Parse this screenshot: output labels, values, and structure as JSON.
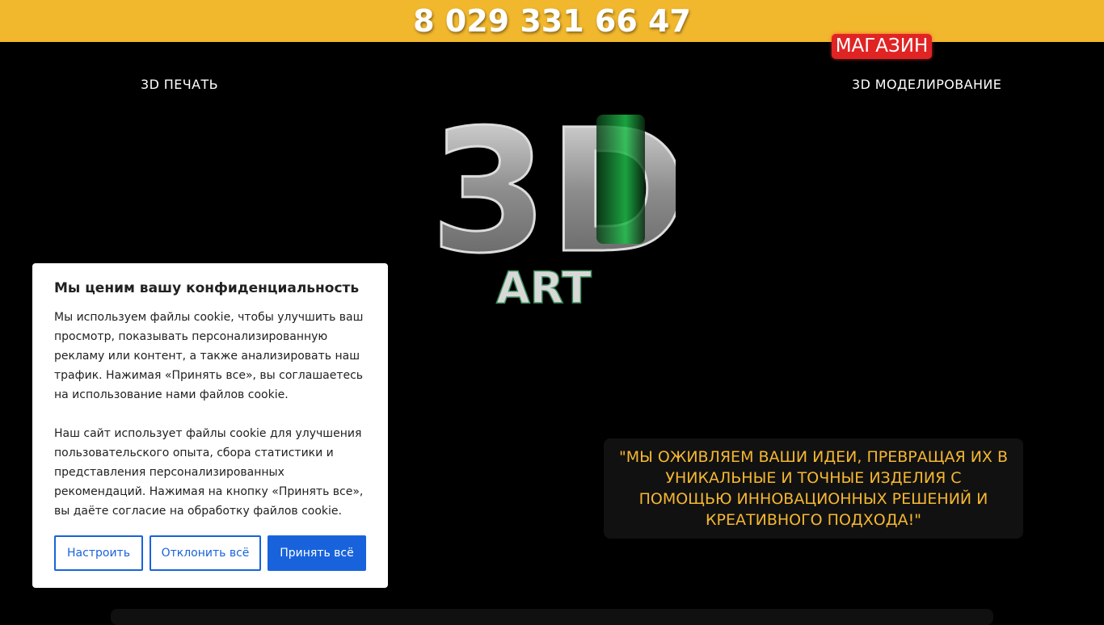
{
  "header": {
    "phone": "8 029 331 66 47"
  },
  "nav": {
    "shop": "МАГАЗИН",
    "left_link": "3D ПЕЧАТЬ",
    "right_link": "3D МОДЕЛИРОВАНИЕ"
  },
  "logo": {
    "main": "3D",
    "sub": "ART"
  },
  "quote": "\"МЫ ОЖИВЛЯЕМ ВАШИ ИДЕИ, ПРЕВРАЩАЯ ИХ В УНИКАЛЬНЫЕ И ТОЧНЫЕ ИЗДЕЛИЯ С ПОМОЩЬЮ ИННОВАЦИОННЫХ РЕШЕНИЙ И КРЕАТИВНОГО ПОДХОДА!\"",
  "cookie": {
    "title": "Мы ценим вашу конфиденциальность",
    "paragraph1": "Мы используем файлы cookie, чтобы улучшить ваш просмотр, показывать персонализированную рекламу или контент, а также анализировать наш трафик. Нажимая «Принять все», вы соглашаетесь на использование нами файлов cookie.",
    "paragraph2": "Наш сайт использует файлы cookie для улучшения пользовательского опыта, сбора статистики и представления персонализированных рекомендаций. Нажимая на кнопку «Принять все», вы даёте согласие на обработку файлов cookie.",
    "buttons": {
      "customize": "Настроить",
      "reject": "Отклонить всё",
      "accept": "Принять всё"
    }
  },
  "colors": {
    "accent": "#f1b72d",
    "shop_badge": "#e02424",
    "quote_text": "#f5b731",
    "cookie_button": "#1863dc"
  }
}
